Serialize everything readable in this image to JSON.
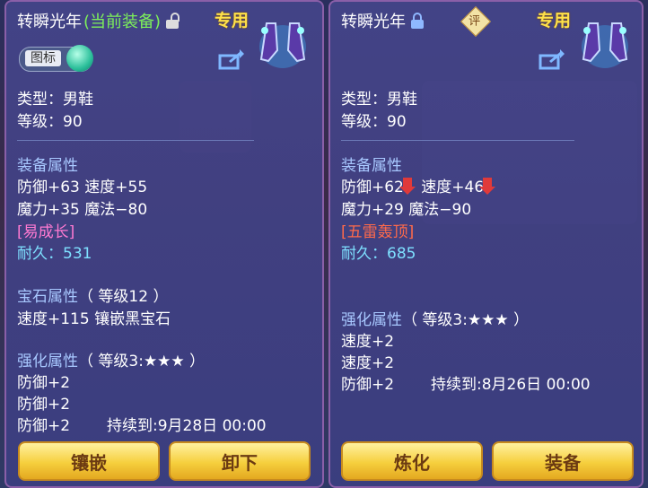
{
  "left": {
    "item_name": "转瞬光年",
    "equipped_note": "(当前装备)",
    "lock_icon": "unlocked-icon",
    "exclusive": "专用",
    "icon_toggle_label": "图标",
    "type": "类型：男鞋",
    "level": "等级：90",
    "equip_header": "装备属性",
    "equip_line1": "防御+63 速度+55",
    "equip_line2": "魔力+35 魔法−80",
    "special": "[易成长]",
    "durability": "耐久：531",
    "gem_header": "宝石属性",
    "gem_level": "（ 等级12 ）",
    "gem_line": "速度+115 镶嵌黑宝石",
    "enhance_header": "强化属性",
    "enhance_level": "（ 等级3:★★★ ）",
    "enhance_lines": [
      "防御+2",
      "防御+2",
      "防御+2"
    ],
    "duration": "持续到:9月28日 00:00",
    "buttons": [
      "镶嵌",
      "卸下"
    ]
  },
  "right": {
    "item_name": "转瞬光年",
    "lock_icon": "locked-icon",
    "rate_badge": "评",
    "exclusive": "专用",
    "type": "类型：男鞋",
    "level": "等级：90",
    "equip_header": "装备属性",
    "def": "防御+62",
    "spd": "速度+46",
    "equip_line2": "魔力+29 魔法−90",
    "special": "[五雷轰顶]",
    "durability": "耐久：685",
    "enhance_header": "强化属性",
    "enhance_level": "（ 等级3:★★★ ）",
    "enhance_lines": [
      "速度+2",
      "速度+2",
      "防御+2"
    ],
    "duration": "持续到:8月26日 00:00",
    "buttons": [
      "炼化",
      "装备"
    ]
  },
  "colors": {
    "accent_gold": "#f6cf3d",
    "header_blue": "#a8c8ff",
    "value_cyan": "#7ee0ff",
    "down_red": "#e03a3a",
    "equipped_green": "#7df05a"
  }
}
